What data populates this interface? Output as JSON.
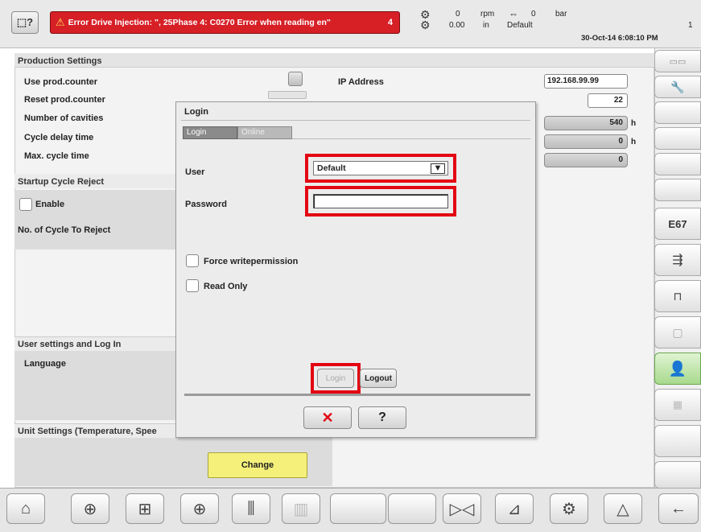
{
  "header": {
    "error_text": "Error Drive Injection: \", 25Phase 4: C0270 Error when reading en\"",
    "error_count": "4",
    "speed_value": "0",
    "speed_unit_top": "rpm",
    "speed_value2": "0.00",
    "speed_unit_bottom": "in",
    "pressure_value": "0",
    "pressure_unit": "bar",
    "user": "Default",
    "page_num": "1",
    "datetime": "30-Oct-14 6:08:10 PM"
  },
  "left_panel": {
    "production_settings_title": "Production Settings",
    "use_prod_counter": "Use prod.counter",
    "reset_prod_counter": "Reset prod.counter",
    "number_of_cavities": "Number of cavities",
    "cycle_delay_time": "Cycle delay time",
    "max_cycle_time": "Max. cycle time",
    "startup_cycle_reject_title": "Startup Cycle Reject",
    "enable_label": "Enable",
    "no_of_cycle_to_reject": "No. of Cycle To Reject",
    "user_settings_title": "User settings and Log In",
    "language_label": "Language",
    "unit_settings_title": "Unit Settings (Temperature, Spee",
    "change_button": "Change"
  },
  "right_panel": {
    "ip_address_label": "IP Address",
    "ip_address_value": "192.168.99.99",
    "cavities_value": "22",
    "cycle_delay_value": "540",
    "cycle_delay_unit": "h",
    "max_cycle_value": "0",
    "max_cycle_unit": "h",
    "extra_value": "0"
  },
  "dialog": {
    "title": "Login",
    "tab_login": "Login",
    "tab_online": "Online",
    "user_label": "User",
    "user_value": "Default",
    "password_label": "Password",
    "password_value": "",
    "force_write_label": "Force writepermission",
    "read_only_label": "Read Only",
    "login_button": "Login",
    "logout_button": "Logout",
    "cancel_symbol": "✕",
    "help_symbol": "?"
  },
  "sidebar": {
    "e67_label": "E67"
  },
  "colors": {
    "error_bar": "#d71f26",
    "highlight": "#e30613",
    "change_button": "#f5f07a"
  }
}
